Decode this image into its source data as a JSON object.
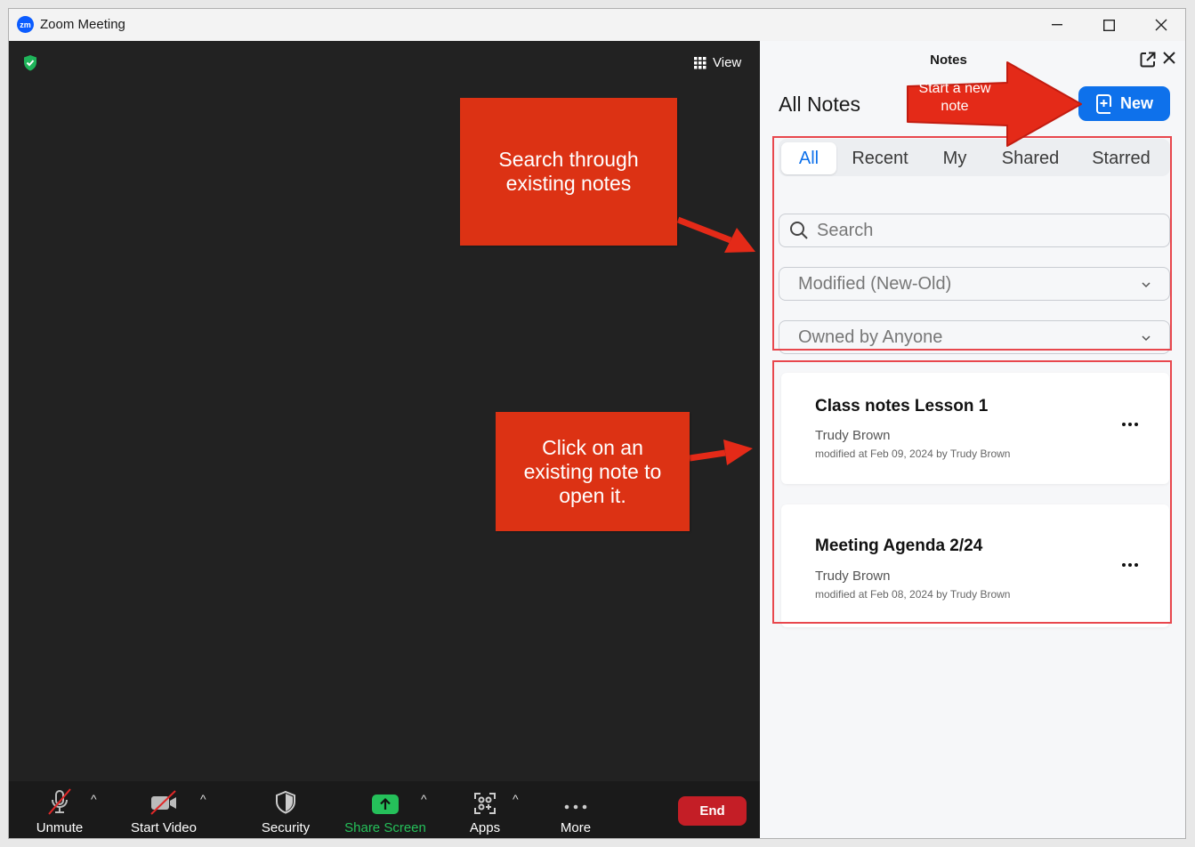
{
  "window": {
    "title": "Zoom Meeting",
    "logo_text": "zm"
  },
  "video": {
    "view_label": "View"
  },
  "toolbar": {
    "unmute_label": "Unmute",
    "start_video_label": "Start Video",
    "security_label": "Security",
    "share_screen_label": "Share Screen",
    "apps_label": "Apps",
    "more_label": "More",
    "end_label": "End",
    "caret": "^"
  },
  "notes_panel": {
    "title": "Notes",
    "heading": "All Notes",
    "new_label": "New",
    "tabs": [
      {
        "label": "All",
        "active": true
      },
      {
        "label": "Recent",
        "active": false
      },
      {
        "label": "My",
        "active": false
      },
      {
        "label": "Shared",
        "active": false
      },
      {
        "label": "Starred",
        "active": false
      }
    ],
    "search_placeholder": "Search",
    "sort_value": "Modified (New-Old)",
    "owner_filter_value": "Owned by Anyone",
    "notes": [
      {
        "title": "Class notes Lesson 1",
        "owner": "Trudy Brown",
        "modified": "modified at Feb 09, 2024 by Trudy Brown"
      },
      {
        "title": "Meeting Agenda 2/24",
        "owner": "Trudy Brown",
        "modified": "modified at Feb 08, 2024 by Trudy Brown"
      }
    ]
  },
  "annotations": {
    "new_note_callout": [
      "Start a new",
      "note"
    ],
    "search_callout": [
      "Search through",
      "existing notes"
    ],
    "open_callout": [
      "Click on an",
      "existing note to",
      "open it."
    ]
  },
  "colors": {
    "accent_blue": "#0e71eb",
    "end_red": "#c41e26",
    "share_green": "#25c05a",
    "callout_red": "#dc3214",
    "highlight_red": "#e8474d"
  }
}
